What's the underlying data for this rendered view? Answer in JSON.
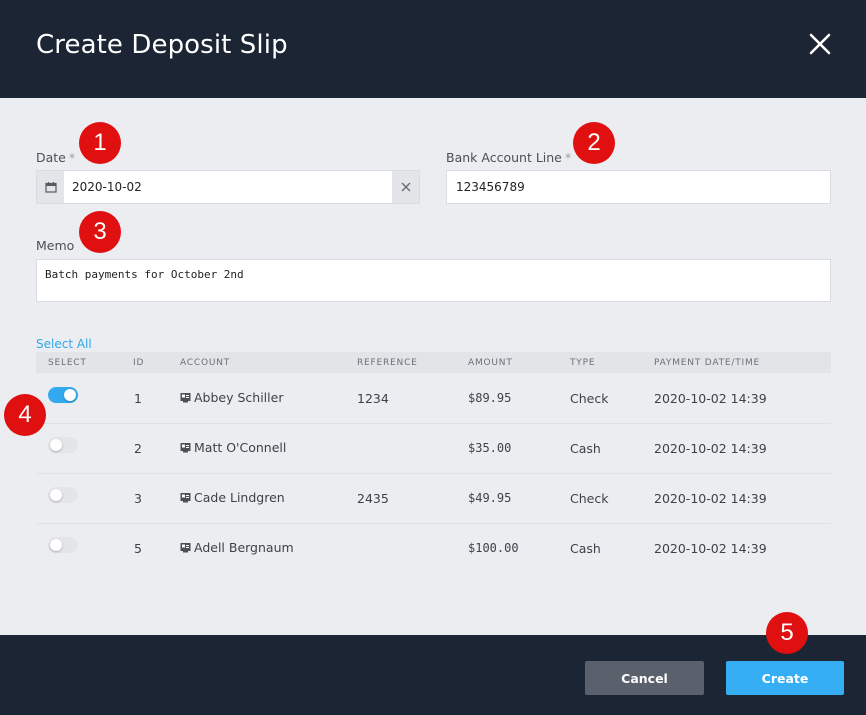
{
  "dialog": {
    "title": "Create Deposit Slip"
  },
  "form": {
    "date": {
      "label": "Date",
      "required_mark": "*",
      "value": "2020-10-02"
    },
    "bank_account": {
      "label": "Bank Account Line",
      "required_mark": "*",
      "value": "123456789"
    },
    "memo": {
      "label": "Memo",
      "value": "Batch payments for October 2nd"
    }
  },
  "table": {
    "select_all_label": "Select All",
    "headers": {
      "select": "SELECT",
      "id": "ID",
      "account": "ACCOUNT",
      "reference": "REFERENCE",
      "amount": "AMOUNT",
      "type": "TYPE",
      "payment_datetime": "PAYMENT DATE/TIME"
    },
    "rows": [
      {
        "selected": true,
        "id": "1",
        "account": "Abbey Schiller",
        "reference": "1234",
        "amount": "$89.95",
        "type": "Check",
        "datetime": "2020-10-02 14:39"
      },
      {
        "selected": false,
        "id": "2",
        "account": "Matt O'Connell",
        "reference": "",
        "amount": "$35.00",
        "type": "Cash",
        "datetime": "2020-10-02 14:39"
      },
      {
        "selected": false,
        "id": "3",
        "account": "Cade Lindgren",
        "reference": "2435",
        "amount": "$49.95",
        "type": "Check",
        "datetime": "2020-10-02 14:39"
      },
      {
        "selected": false,
        "id": "5",
        "account": "Adell Bergnaum",
        "reference": "",
        "amount": "$100.00",
        "type": "Cash",
        "datetime": "2020-10-02 14:39"
      }
    ]
  },
  "buttons": {
    "cancel": "Cancel",
    "create": "Create"
  },
  "badges": [
    "1",
    "2",
    "3",
    "4",
    "5"
  ],
  "icons": {
    "close": "close-icon",
    "calendar": "calendar-icon",
    "clear": "clear-x-icon",
    "account": "account-card-icon"
  },
  "colors": {
    "header_bg": "#1b2533",
    "accent": "#33aaf0",
    "badge": "#e01010"
  }
}
